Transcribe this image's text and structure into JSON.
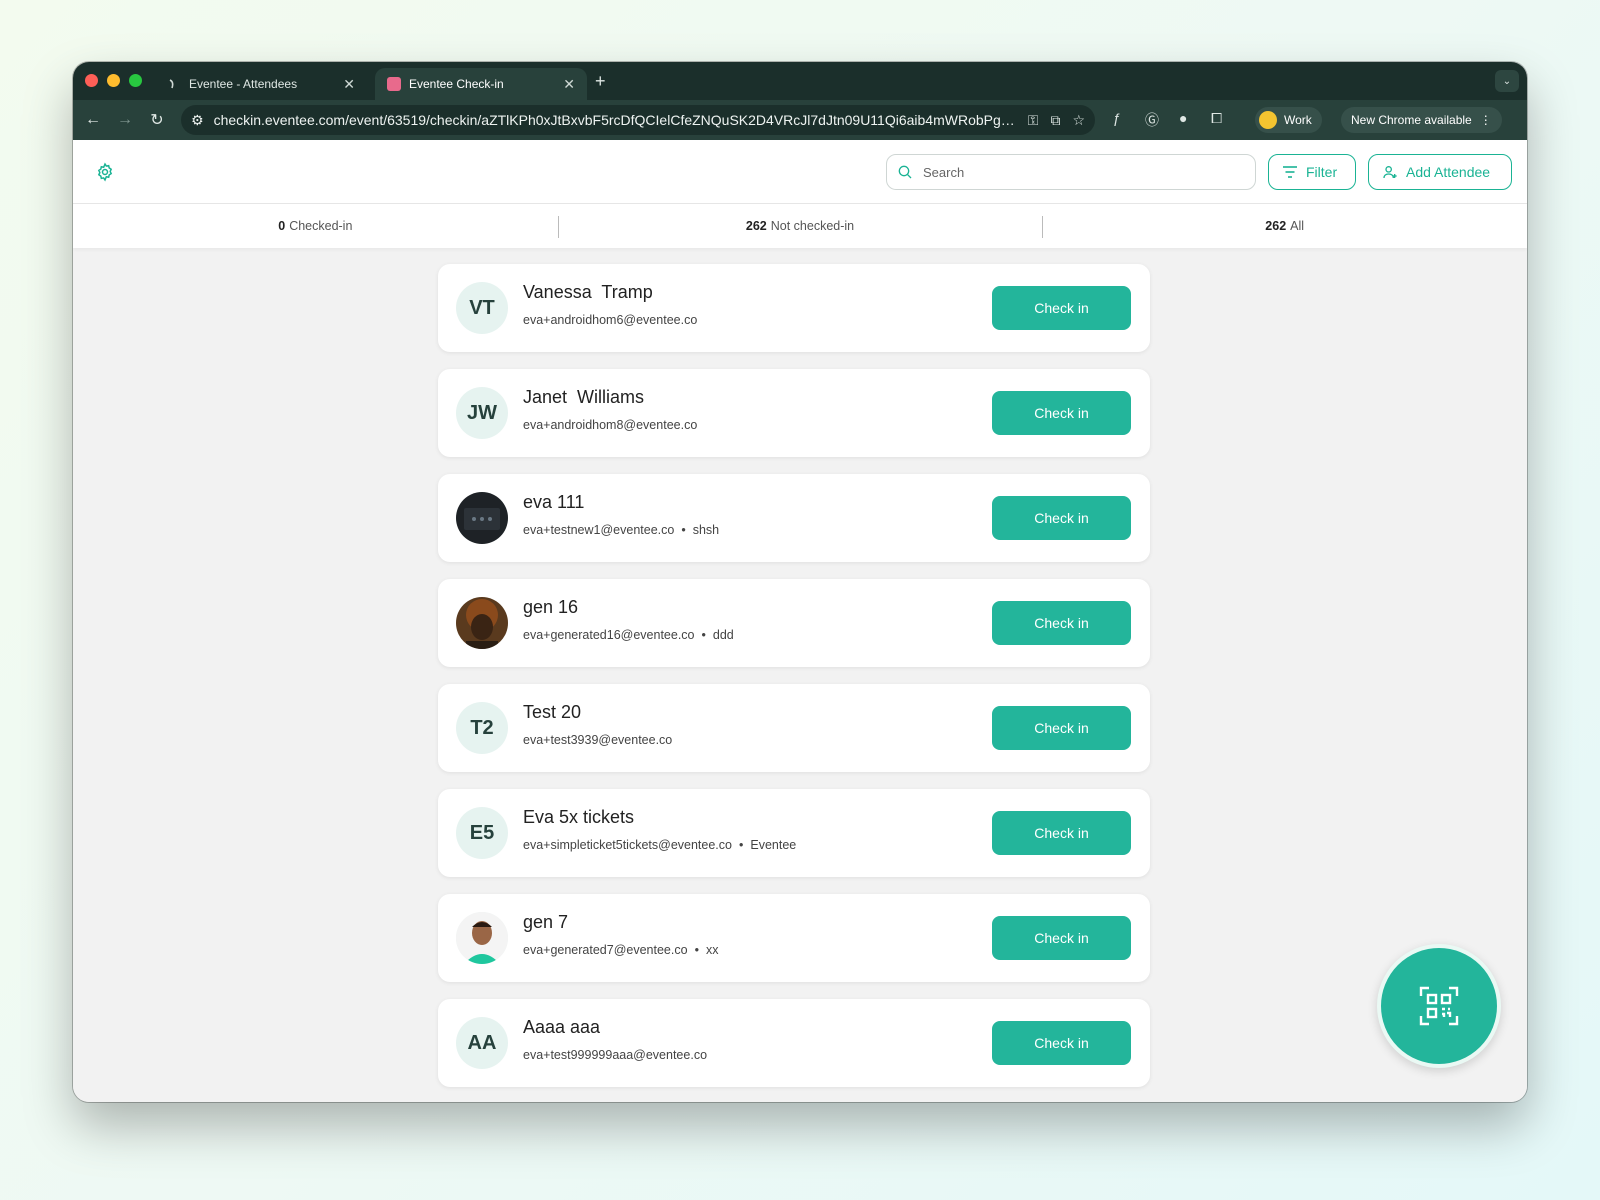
{
  "browser": {
    "tabs": [
      {
        "title": "Eventee - Attendees"
      },
      {
        "title": "Eventee Check-in"
      }
    ],
    "url": "checkin.eventee.com/event/63519/checkin/aZTlKPh0xJtBxvbF5rcDfQCIelCfeZNQuSK2D4VRcJl7dJtn09U11Qi6aib4mWRobPgxE...",
    "profile_label": "Work",
    "update_label": "New Chrome available"
  },
  "header": {
    "search_placeholder": "Search",
    "filter_label": "Filter",
    "add_label": "Add Attendee"
  },
  "stats": [
    {
      "count": "0",
      "label": "Checked-in"
    },
    {
      "count": "262",
      "label": "Not checked-in"
    },
    {
      "count": "262",
      "label": "All"
    }
  ],
  "attendees": [
    {
      "initials": "VT",
      "name": "Vanessa  Tramp",
      "email": "eva+androidhom6@eventee.co",
      "extra": "",
      "photo": ""
    },
    {
      "initials": "JW",
      "name": "Janet  Williams",
      "email": "eva+androidhom8@eventee.co",
      "extra": "",
      "photo": ""
    },
    {
      "initials": "",
      "name": "eva 111",
      "email": "eva+testnew1@eventee.co",
      "extra": "shsh",
      "photo": "dark"
    },
    {
      "initials": "",
      "name": "gen 16",
      "email": "eva+generated16@eventee.co",
      "extra": "ddd",
      "photo": "portrait-brown"
    },
    {
      "initials": "T2",
      "name": "Test 20",
      "email": "eva+test3939@eventee.co",
      "extra": "",
      "photo": ""
    },
    {
      "initials": "E5",
      "name": "Eva 5x tickets",
      "email": "eva+simpleticket5tickets@eventee.co",
      "extra": "Eventee",
      "photo": ""
    },
    {
      "initials": "",
      "name": "gen 7",
      "email": "eva+generated7@eventee.co",
      "extra": "xx",
      "photo": "portrait-green"
    },
    {
      "initials": "AA",
      "name": "Aaaa aaa",
      "email": "eva+test999999aaa@eventee.co",
      "extra": "",
      "photo": ""
    }
  ],
  "checkin_label": "Check in",
  "colors": {
    "accent": "#23b59b",
    "browser_dark": "#1b2f2b",
    "browser_toolbar": "#28413b"
  },
  "icons": [
    "settings-gear-icon",
    "search-icon",
    "filter-icon",
    "add-person-icon",
    "qr-scan-icon"
  ]
}
